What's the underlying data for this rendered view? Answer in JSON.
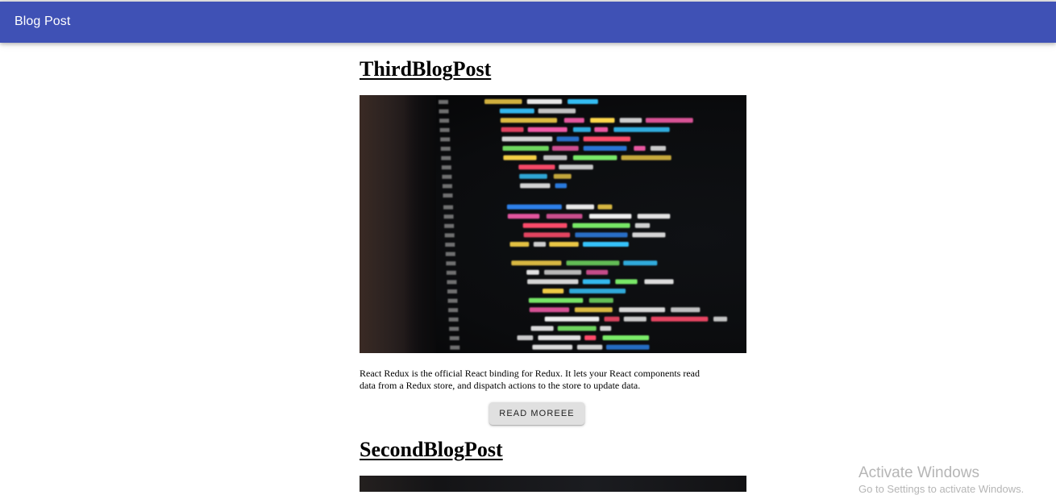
{
  "appbar": {
    "title": "Blog Post"
  },
  "posts": [
    {
      "title": "ThirdBlogPost",
      "image_alt": "laptop-screen-code",
      "excerpt": "React Redux is the official React binding for Redux. It lets your React components read data from a Redux store, and dispatch actions to the store to update data.",
      "button_label": "READ MOREEE"
    },
    {
      "title": "SecondBlogPost",
      "image_alt": "laptop-screen-code"
    }
  ],
  "watermark": {
    "title": "Activate Windows",
    "subtitle": "Go to Settings to activate Windows."
  },
  "colors": {
    "appbar": "#3f51b5",
    "button": "#e0e0e0"
  }
}
